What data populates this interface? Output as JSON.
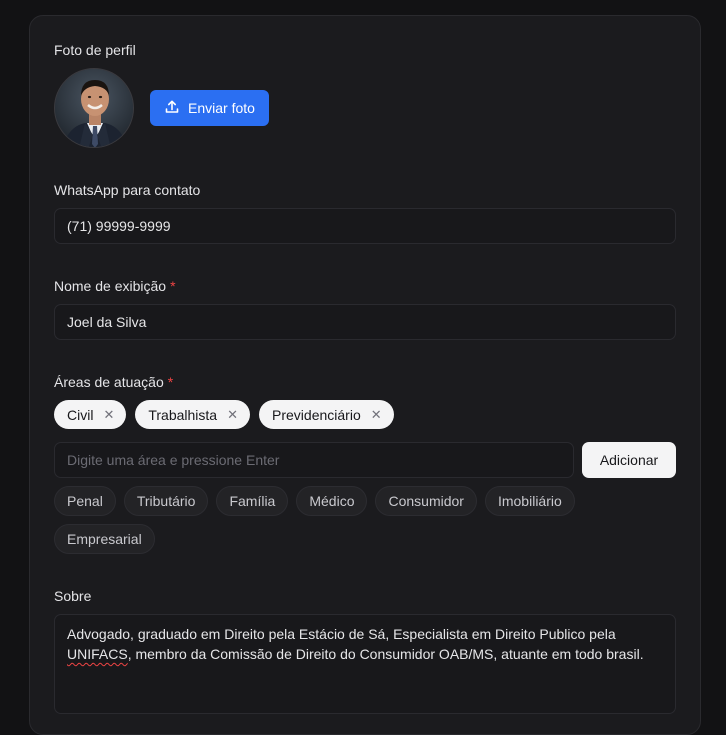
{
  "profile_photo": {
    "label": "Foto de perfil",
    "upload_button": "Enviar foto"
  },
  "whatsapp": {
    "label": "WhatsApp para contato",
    "value": "(71) 99999-9999"
  },
  "display_name": {
    "label": "Nome de exibição",
    "required_mark": "*",
    "value": "Joel da Silva"
  },
  "areas": {
    "label": "Áreas de atuação",
    "required_mark": "*",
    "selected": [
      "Civil",
      "Trabalhista",
      "Previdenciário"
    ],
    "remove_glyph": "✕",
    "input_placeholder": "Digite uma área e pressione Enter",
    "add_button": "Adicionar",
    "suggestions_row1": [
      "Penal",
      "Tributário",
      "Família",
      "Médico",
      "Consumidor",
      "Imobiliário"
    ],
    "suggestions_row2": [
      "Empresarial"
    ]
  },
  "about": {
    "label": "Sobre",
    "text_before": "Advogado, graduado em Direito pela Estácio de Sá, Especialista em Direito Publico pela ",
    "text_flagged": "UNIFACS",
    "text_after": ", membro da Comissão de Direito do Consumidor OAB/MS, atuante em todo brasil."
  },
  "colors": {
    "accent": "#2b6ff2",
    "required": "#ef4444",
    "background": "#121214",
    "card": "#1b1b1e"
  },
  "icons": {
    "upload": "upload-icon",
    "remove": "close-icon"
  }
}
